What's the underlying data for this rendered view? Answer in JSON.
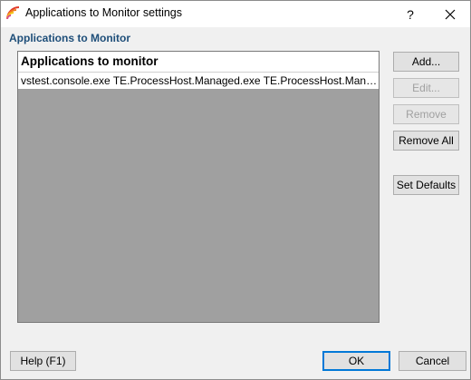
{
  "window": {
    "title": "Applications to Monitor settings",
    "help_glyph": "?",
    "close_glyph": "✕"
  },
  "section": {
    "title": "Applications to Monitor"
  },
  "list": {
    "header": "Applications to monitor",
    "rows": [
      "vstest.console.exe TE.ProcessHost.Managed.exe TE.ProcessHost.Manage..."
    ]
  },
  "side_buttons": {
    "add": "Add...",
    "edit": "Edit...",
    "remove": "Remove",
    "remove_all": "Remove All",
    "set_defaults": "Set Defaults"
  },
  "footer_buttons": {
    "help": "Help (F1)",
    "ok": "OK",
    "cancel": "Cancel"
  },
  "colors": {
    "section_title": "#1e4e79",
    "list_background": "#a0a0a0",
    "default_button_border": "#0078d7"
  }
}
